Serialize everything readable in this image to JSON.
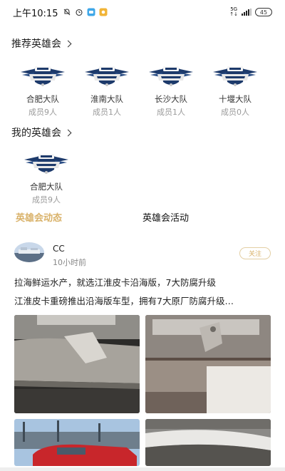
{
  "status_bar": {
    "time": "上午10:15",
    "network": "5G",
    "battery": "45"
  },
  "recommended": {
    "title": "推荐英雄会",
    "clubs": [
      {
        "name": "合肥大队",
        "members": "成员9人"
      },
      {
        "name": "淮南大队",
        "members": "成员1人"
      },
      {
        "name": "长沙大队",
        "members": "成员1人"
      },
      {
        "name": "十堰大队",
        "members": "成员0人"
      }
    ]
  },
  "mine": {
    "title": "我的英雄会",
    "clubs": [
      {
        "name": "合肥大队",
        "members": "成员9人"
      }
    ]
  },
  "tabs": {
    "active": "英雄会动态",
    "other": "英雄会活动"
  },
  "post": {
    "username": "CC",
    "time": "10小时前",
    "follow_label": "关注",
    "line1": "拉海鲜运水产，就选江淮皮卡沿海版，7大防腐升级",
    "line2": "江淮皮卡重磅推出沿海版车型，拥有7大原厂防腐升级…"
  },
  "colors": {
    "accent": "#d9b26a",
    "logo_shield": "#1d3a6b",
    "logo_banner": "#f0f0f0"
  }
}
